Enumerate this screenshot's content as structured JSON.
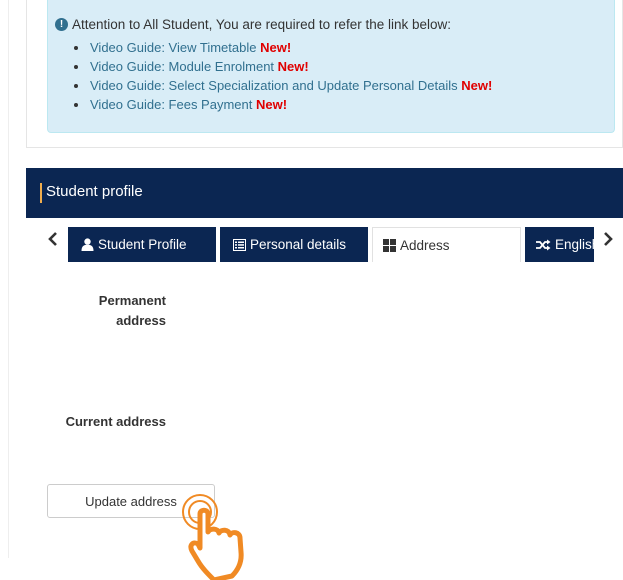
{
  "notice": {
    "heading": "Attention to All Student, You are required to refer the link below:",
    "items": [
      {
        "text": "Video Guide: View Timetable",
        "badge": "New!"
      },
      {
        "text": "Video Guide: Module Enrolment",
        "badge": "New!"
      },
      {
        "text": "Video Guide: Select Specialization and Update Personal Details",
        "badge": "New!"
      },
      {
        "text": "Video Guide: Fees Payment",
        "badge": "New!"
      }
    ]
  },
  "panel": {
    "title": "Student profile"
  },
  "tabs": [
    {
      "label": "Student Profile",
      "icon": "user-icon",
      "active": false
    },
    {
      "label": "Personal details",
      "icon": "list-icon",
      "active": false
    },
    {
      "label": "Address",
      "icon": "grid-icon",
      "active": true
    },
    {
      "label": "English",
      "icon": "shuffle-icon",
      "active": false
    }
  ],
  "address": {
    "permanent_label_line1": "Permanent",
    "permanent_label_line2": "address",
    "current_label": "Current address",
    "update_button": "Update address"
  },
  "colors": {
    "navy": "#0b2652",
    "alert_bg": "#d9edf7",
    "link": "#31708f",
    "new_badge": "#e00000",
    "hand_cursor": "#f08a24"
  }
}
